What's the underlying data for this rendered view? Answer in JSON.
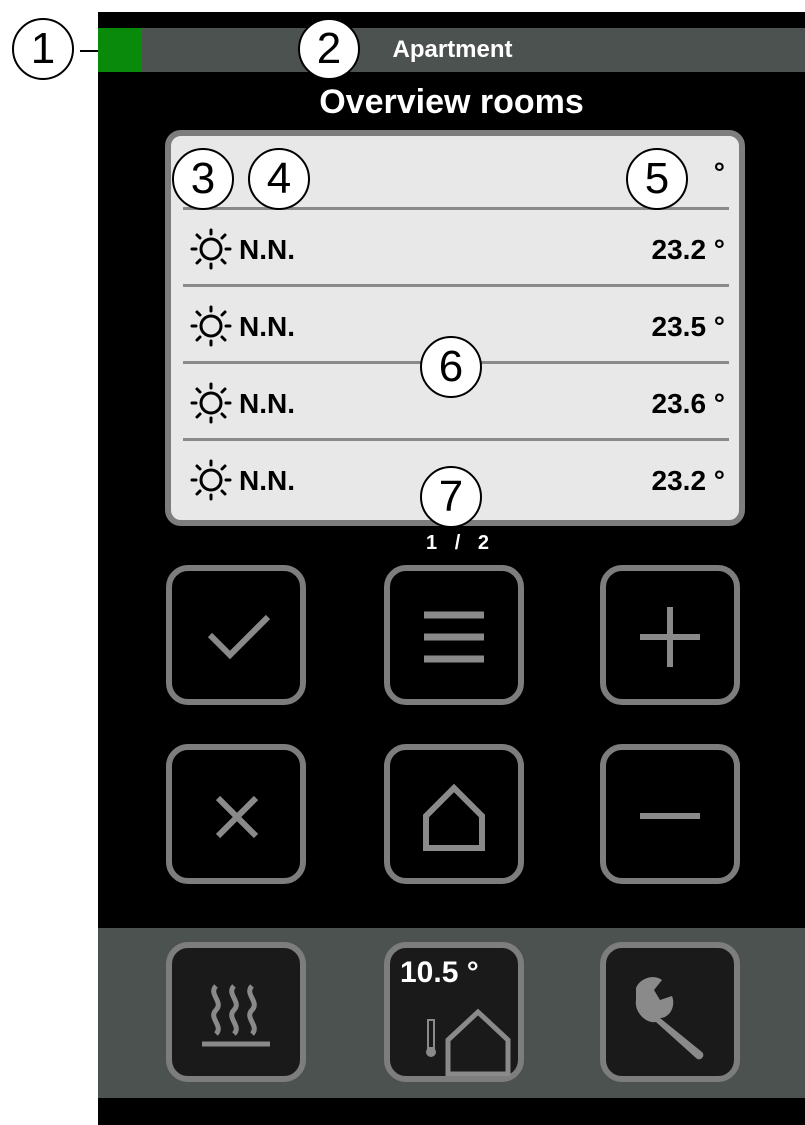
{
  "header": {
    "title": "Apartment",
    "status_color": "#0a8a0a"
  },
  "page_title": "Overview rooms",
  "rooms": [
    {
      "name": "",
      "temp": "°",
      "icon": "sun-icon"
    },
    {
      "name": "N.N.",
      "temp": "23.2 °",
      "icon": "sun-icon"
    },
    {
      "name": "N.N.",
      "temp": "23.5 °",
      "icon": "sun-icon"
    },
    {
      "name": "N.N.",
      "temp": "23.6 °",
      "icon": "sun-icon"
    },
    {
      "name": "N.N.",
      "temp": "23.2 °",
      "icon": "sun-icon"
    }
  ],
  "pager": {
    "current": "1",
    "separator": "/",
    "total": "2"
  },
  "buttons": {
    "row1": [
      "check-icon",
      "menu-icon",
      "plus-icon"
    ],
    "row2": [
      "close-icon",
      "home-icon",
      "minus-icon"
    ],
    "bottom": [
      "heating-icon",
      "thermostat-icon",
      "wrench-icon"
    ]
  },
  "thermostat": {
    "value": "10.5 °"
  },
  "callouts": [
    "1",
    "2",
    "3",
    "4",
    "5",
    "6",
    "7"
  ],
  "colors": {
    "background": "#000000",
    "bar": "#4b524f",
    "panel": "#e8e8e8",
    "border": "#7d7d7d",
    "status_led": "#0a8a0a"
  }
}
